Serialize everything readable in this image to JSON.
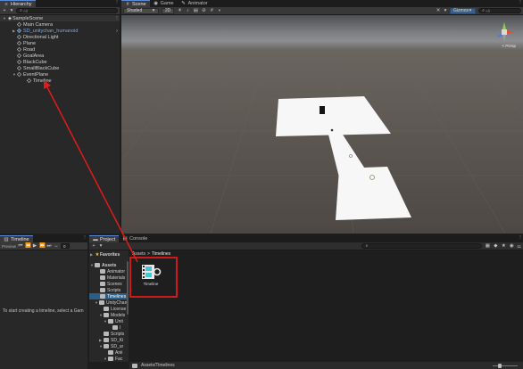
{
  "hierarchy": {
    "tab": "Hierarchy",
    "search_placeholder": "All",
    "items": [
      {
        "label": "SampleScene"
      },
      {
        "label": "Main Camera"
      },
      {
        "label": "SD_unitychan_humanoid"
      },
      {
        "label": "Directional Light"
      },
      {
        "label": "Plane"
      },
      {
        "label": "Road"
      },
      {
        "label": "GoalArea"
      },
      {
        "label": "BlackCube"
      },
      {
        "label": "SmallBlackCube"
      },
      {
        "label": "EventPlane"
      },
      {
        "label": "Timeline"
      }
    ]
  },
  "scene_view": {
    "tabs": [
      "Scene",
      "Game",
      "Animator"
    ],
    "shading": "Shaded",
    "mode_2d": "2D",
    "gizmos": "Gizmos",
    "search_placeholder": "All",
    "persp_label": "< Persp"
  },
  "timeline": {
    "tab": "Timeline",
    "preview_label": "Preview",
    "frame_value": "0",
    "empty_message": "To start creating a timeline, select a Gam"
  },
  "project": {
    "tabs": [
      "Project",
      "Console"
    ],
    "favorites": "Favorites",
    "breadcrumb": [
      "Assets",
      "Timelines"
    ],
    "tree": [
      {
        "label": "Assets"
      },
      {
        "label": "Animator"
      },
      {
        "label": "Materials"
      },
      {
        "label": "Scenes"
      },
      {
        "label": "Scripts"
      },
      {
        "label": "Timelines"
      },
      {
        "label": "UnityChan"
      },
      {
        "label": "License"
      },
      {
        "label": "Models"
      },
      {
        "label": "Unit"
      },
      {
        "label": "I"
      },
      {
        "label": "Scripts"
      },
      {
        "label": "SD_Ki"
      },
      {
        "label": "SD_ur"
      },
      {
        "label": "Anii"
      },
      {
        "label": "Fac"
      },
      {
        "label": "L"
      },
      {
        "label": "U"
      }
    ],
    "asset_name": "Timeline",
    "status_path": "Assets/Timelines",
    "hidden_count": "11"
  },
  "colors": {
    "highlight_box": "#e01b1b",
    "selection": "#2c5d87",
    "prefab_text": "#79a7e6",
    "timeline_teal": "#43c7d4"
  }
}
